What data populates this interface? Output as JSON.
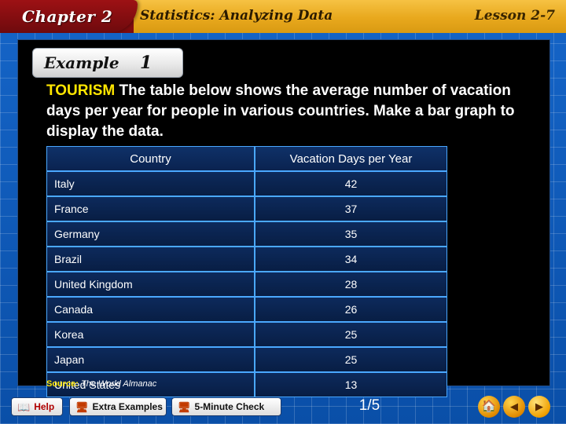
{
  "header": {
    "chapter": "Chapter 2",
    "title": "Statistics: Analyzing Data",
    "lesson": "Lesson 2-7"
  },
  "example": {
    "word": "Example",
    "number": "1"
  },
  "prompt": {
    "keyword": "TOURISM",
    "body": "The table below shows the average number of vacation days per year for people in various countries. Make a bar graph to display the data."
  },
  "table": {
    "headers": [
      "Country",
      "Vacation Days per Year"
    ],
    "rows": [
      {
        "country": "Italy",
        "value": "42"
      },
      {
        "country": "France",
        "value": "37"
      },
      {
        "country": "Germany",
        "value": "35"
      },
      {
        "country": "Brazil",
        "value": "34"
      },
      {
        "country": "United Kingdom",
        "value": "28"
      },
      {
        "country": "Canada",
        "value": "26"
      },
      {
        "country": "Korea",
        "value": "25"
      },
      {
        "country": "Japan",
        "value": "25"
      },
      {
        "country": "United States",
        "value": "13"
      }
    ]
  },
  "source": {
    "label": "Source:",
    "text": "The World Almanac"
  },
  "footer": {
    "help_label": "Help",
    "help_icon": "book-icon",
    "extra_examples_label": "Extra Examples",
    "extra_examples_icon": "monitor-icon",
    "five_minute_check_label": "5-Minute Check",
    "five_minute_check_icon": "monitor-icon",
    "page_indicator": "1/5",
    "home_icon": "home-icon",
    "prev_icon": "previous-arrow-icon",
    "next_icon": "next-arrow-icon"
  }
}
